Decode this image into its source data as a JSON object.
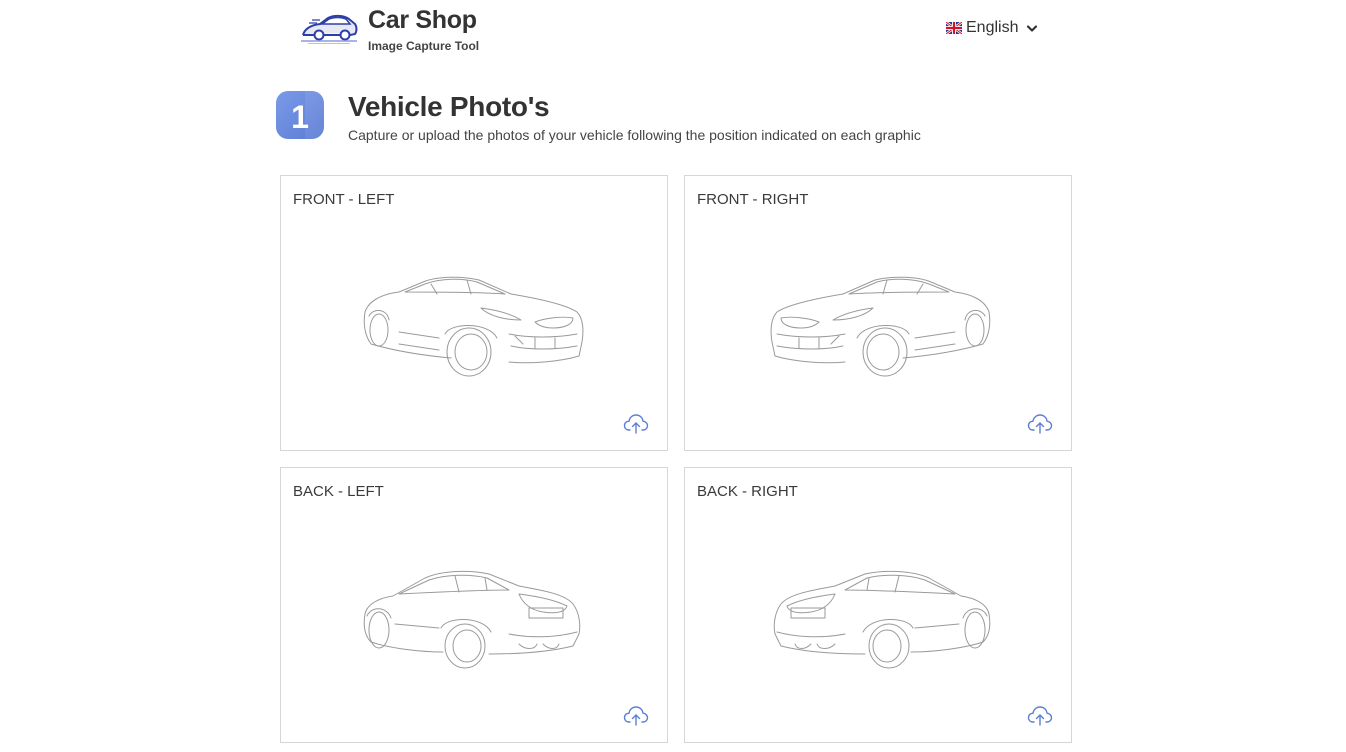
{
  "header": {
    "brand_title": "Car Shop",
    "brand_subtitle": "Image Capture Tool",
    "logo_icon": "car-logo-icon",
    "language": {
      "selected": "English",
      "flag_icon": "uk-flag-icon",
      "chevron_icon": "chevron-down-icon"
    }
  },
  "section": {
    "step_number": "1",
    "title": "Vehicle Photo's",
    "description": "Capture or upload the photos of your vehicle following the position indicated on each graphic"
  },
  "photos": [
    {
      "label": "FRONT - LEFT",
      "illustration": "car-front-left-icon",
      "upload_icon": "cloud-upload-icon"
    },
    {
      "label": "FRONT - RIGHT",
      "illustration": "car-front-right-icon",
      "upload_icon": "cloud-upload-icon"
    },
    {
      "label": "BACK - LEFT",
      "illustration": "car-back-left-icon",
      "upload_icon": "cloud-upload-icon"
    },
    {
      "label": "BACK - RIGHT",
      "illustration": "car-back-right-icon",
      "upload_icon": "cloud-upload-icon"
    }
  ],
  "colors": {
    "accent": "#5b7fd6",
    "badge": "#6e8fe0",
    "text": "#333333",
    "card_border": "#d6d6d6"
  }
}
